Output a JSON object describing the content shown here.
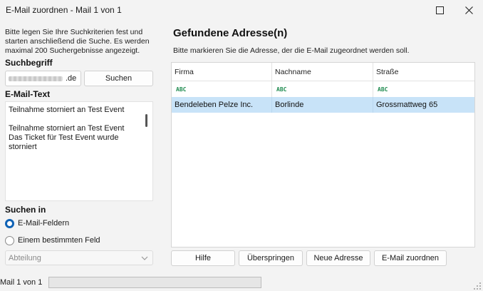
{
  "window": {
    "title": "E-Mail zuordnen - Mail 1 von 1",
    "maximize_icon": "maximize-icon",
    "close_icon": "close-icon"
  },
  "left": {
    "intro_text": "Bitte legen Sie Ihre Suchkriterien fest und starten anschließend die Suche. Es werden maximal 200 Suchergebnisse angezeigt.",
    "search_label": "Suchbegriff",
    "search_value_suffix": ".de",
    "search_button": "Suchen",
    "mail_text_label": "E-Mail-Text",
    "mail_text_lines": [
      "Teilnahme storniert an Test Event",
      "",
      "Teilnahme storniert an Test Event",
      "Das Ticket für Test Event wurde",
      "storniert"
    ],
    "search_in_label": "Suchen in",
    "radio_options": [
      {
        "label": "E-Mail-Feldern",
        "selected": true
      },
      {
        "label": "Einem bestimmten Feld",
        "selected": false
      }
    ],
    "field_select_value": "Abteilung"
  },
  "right": {
    "heading": "Gefundene Adresse(n)",
    "subheading": "Bitte markieren Sie die Adresse, der die E-Mail zugeordnet werden soll.",
    "columns": [
      "Firma",
      "Nachname",
      "Straße"
    ],
    "filter_icon": "abc-filter-icon",
    "rows": [
      {
        "firma": "Bendeleben Pelze Inc.",
        "nachname": "Borlinde",
        "strasse": "Grossmattweg 65",
        "selected": true
      }
    ],
    "buttons": {
      "help": "Hilfe",
      "skip": "Überspringen",
      "new_address": "Neue Adresse",
      "assign": "E-Mail zuordnen"
    }
  },
  "status": {
    "text": "Mail 1 von 1",
    "progress": 0
  },
  "colors": {
    "accent": "#0f62b5",
    "selection": "#c8e3f8"
  }
}
